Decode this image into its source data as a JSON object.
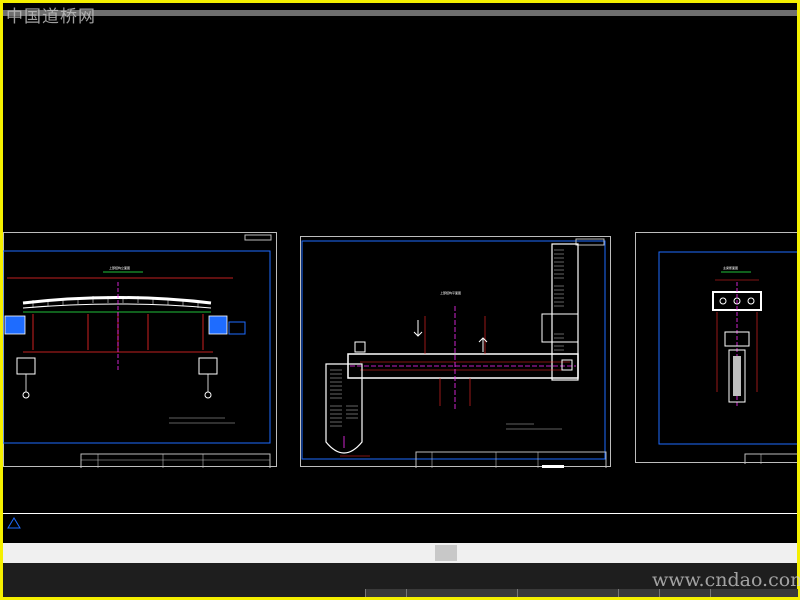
{
  "watermark": {
    "site_name": "中国道桥网",
    "site_url": "www.cndao.com"
  },
  "colors": {
    "frame": "#f5f000",
    "background": "#000000",
    "sheet_border": "#bdbdbd",
    "inner_border": "#1e6cff",
    "axis_magenta": "#ff2cff",
    "dim_red": "#ff2a2a",
    "drawing_white": "#ffffff",
    "green_accent": "#1fbf3a"
  },
  "sheets": [
    {
      "name": "elevation-sheet"
    },
    {
      "name": "plan-sheet"
    },
    {
      "name": "section-sheet"
    }
  ]
}
